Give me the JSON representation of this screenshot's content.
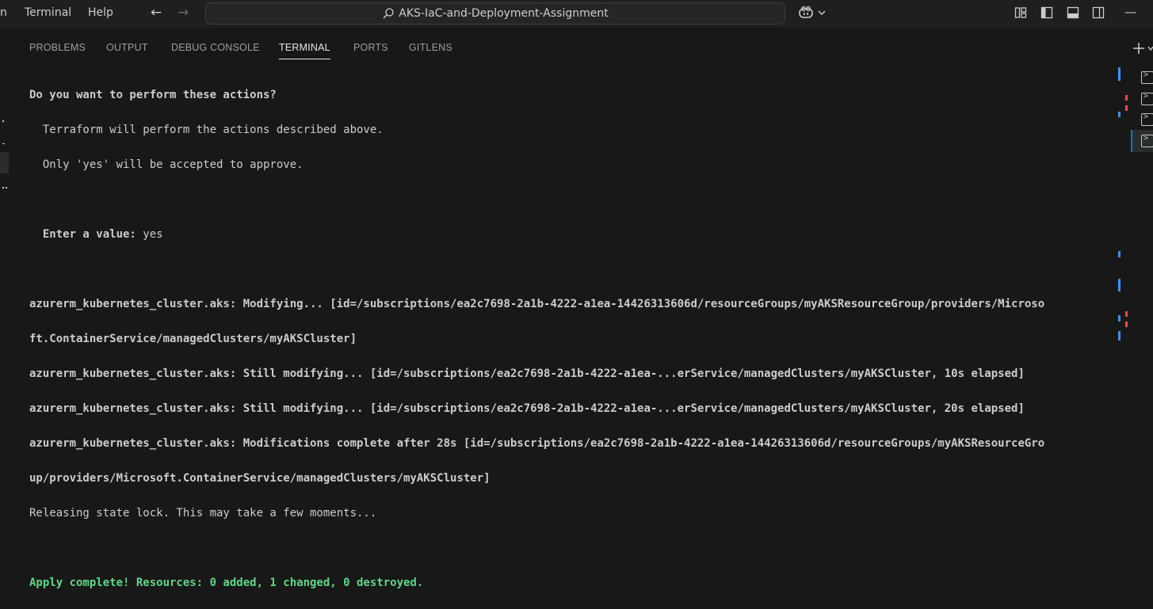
{
  "menu": {
    "partial_item": "n",
    "terminal": "Terminal",
    "help": "Help"
  },
  "search": {
    "value": "AKS-IaC-and-Deployment-Assignment"
  },
  "panel_tabs": [
    "PROBLEMS",
    "OUTPUT",
    "DEBUG CONSOLE",
    "TERMINAL",
    "PORTS",
    "GITLENS"
  ],
  "active_tab": "TERMINAL",
  "terminal": {
    "prompt_question": "Do you want to perform these actions?",
    "prompt_line1": "  Terraform will perform the actions described above.",
    "prompt_line2": "  Only 'yes' will be accepted to approve.",
    "enter_label": "  Enter a value:",
    "enter_value": " yes",
    "modifying_line1": "azurerm_kubernetes_cluster.aks: Modifying... [id=/subscriptions/ea2c7698-2a1b-4222-a1ea-14426313606d/resourceGroups/myAKSResourceGroup/providers/Microso",
    "modifying_line2": "ft.ContainerService/managedClusters/myAKSCluster]",
    "still_10": "azurerm_kubernetes_cluster.aks: Still modifying... [id=/subscriptions/ea2c7698-2a1b-4222-a1ea-...erService/managedClusters/myAKSCluster, 10s elapsed]",
    "still_20": "azurerm_kubernetes_cluster.aks: Still modifying... [id=/subscriptions/ea2c7698-2a1b-4222-a1ea-...erService/managedClusters/myAKSCluster, 20s elapsed]",
    "complete_line1": "azurerm_kubernetes_cluster.aks: Modifications complete after 28s [id=/subscriptions/ea2c7698-2a1b-4222-a1ea-14426313606d/resourceGroups/myAKSResourceGro",
    "complete_line2": "up/providers/Microsoft.ContainerService/managedClusters/myAKSCluster]",
    "releasing": "Releasing state lock. This may take a few moments...",
    "apply_complete": "Apply complete! Resources: 0 added, 1 changed, 0 destroyed."
  },
  "icons": {
    "back": "arrow-left-icon",
    "forward": "arrow-right-icon",
    "search": "search-icon",
    "copilot": "copilot-icon",
    "layout": "customize-layout-icon",
    "sidebar": "toggle-primary-sidebar-icon",
    "panel": "toggle-panel-icon",
    "secondary": "toggle-secondary-sidebar-icon",
    "new_terminal": "plus-icon",
    "terminal_instance": "terminal-icon"
  },
  "colors": {
    "background": "#181818",
    "titlebar": "#1f1f1f",
    "success": "#5fd788",
    "scroll_blue": "#3794ff",
    "scroll_red": "#f14c4c"
  }
}
